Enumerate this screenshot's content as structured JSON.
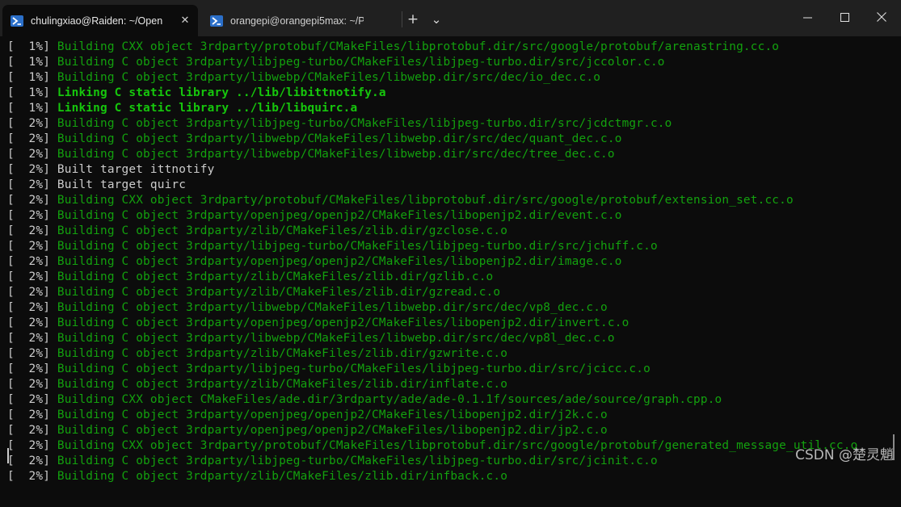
{
  "tabs": [
    {
      "title": "chulingxiao@Raiden: ~/Open",
      "active": true
    },
    {
      "title": "orangepi@orangepi5max: ~/P",
      "active": false
    }
  ],
  "titlebar": {
    "new_tab": "+",
    "dropdown": "⌄",
    "minimize": "─",
    "maximize": "□",
    "close": "✕"
  },
  "colors": {
    "normal_output": "#13a10e",
    "bold_output": "#16c60c",
    "default_text": "#cccccc",
    "background": "#0c0c0c"
  },
  "terminal_lines": [
    {
      "pct": "[  1%] ",
      "text": "Building CXX object 3rdparty/protobuf/CMakeFiles/libprotobuf.dir/src/google/protobuf/arenastring.cc.o",
      "style": "green"
    },
    {
      "pct": "[  1%] ",
      "text": "Building C object 3rdparty/libjpeg-turbo/CMakeFiles/libjpeg-turbo.dir/src/jccolor.c.o",
      "style": "green"
    },
    {
      "pct": "[  1%] ",
      "text": "Building C object 3rdparty/libwebp/CMakeFiles/libwebp.dir/src/dec/io_dec.c.o",
      "style": "green"
    },
    {
      "pct": "[  1%] ",
      "text": "Linking C static library ../lib/libittnotify.a",
      "style": "bright"
    },
    {
      "pct": "[  1%] ",
      "text": "Linking C static library ../lib/libquirc.a",
      "style": "bright"
    },
    {
      "pct": "[  2%] ",
      "text": "Building C object 3rdparty/libjpeg-turbo/CMakeFiles/libjpeg-turbo.dir/src/jcdctmgr.c.o",
      "style": "green"
    },
    {
      "pct": "[  2%] ",
      "text": "Building C object 3rdparty/libwebp/CMakeFiles/libwebp.dir/src/dec/quant_dec.c.o",
      "style": "green"
    },
    {
      "pct": "[  2%] ",
      "text": "Building C object 3rdparty/libwebp/CMakeFiles/libwebp.dir/src/dec/tree_dec.c.o",
      "style": "green"
    },
    {
      "pct": "[  2%] ",
      "text": "Built target ittnotify",
      "style": "white"
    },
    {
      "pct": "[  2%] ",
      "text": "Built target quirc",
      "style": "white"
    },
    {
      "pct": "[  2%] ",
      "text": "Building CXX object 3rdparty/protobuf/CMakeFiles/libprotobuf.dir/src/google/protobuf/extension_set.cc.o",
      "style": "green"
    },
    {
      "pct": "[  2%] ",
      "text": "Building C object 3rdparty/openjpeg/openjp2/CMakeFiles/libopenjp2.dir/event.c.o",
      "style": "green"
    },
    {
      "pct": "[  2%] ",
      "text": "Building C object 3rdparty/zlib/CMakeFiles/zlib.dir/gzclose.c.o",
      "style": "green"
    },
    {
      "pct": "[  2%] ",
      "text": "Building C object 3rdparty/libjpeg-turbo/CMakeFiles/libjpeg-turbo.dir/src/jchuff.c.o",
      "style": "green"
    },
    {
      "pct": "[  2%] ",
      "text": "Building C object 3rdparty/openjpeg/openjp2/CMakeFiles/libopenjp2.dir/image.c.o",
      "style": "green"
    },
    {
      "pct": "[  2%] ",
      "text": "Building C object 3rdparty/zlib/CMakeFiles/zlib.dir/gzlib.c.o",
      "style": "green"
    },
    {
      "pct": "[  2%] ",
      "text": "Building C object 3rdparty/zlib/CMakeFiles/zlib.dir/gzread.c.o",
      "style": "green"
    },
    {
      "pct": "[  2%] ",
      "text": "Building C object 3rdparty/libwebp/CMakeFiles/libwebp.dir/src/dec/vp8_dec.c.o",
      "style": "green"
    },
    {
      "pct": "[  2%] ",
      "text": "Building C object 3rdparty/openjpeg/openjp2/CMakeFiles/libopenjp2.dir/invert.c.o",
      "style": "green"
    },
    {
      "pct": "[  2%] ",
      "text": "Building C object 3rdparty/libwebp/CMakeFiles/libwebp.dir/src/dec/vp8l_dec.c.o",
      "style": "green"
    },
    {
      "pct": "[  2%] ",
      "text": "Building C object 3rdparty/zlib/CMakeFiles/zlib.dir/gzwrite.c.o",
      "style": "green"
    },
    {
      "pct": "[  2%] ",
      "text": "Building C object 3rdparty/libjpeg-turbo/CMakeFiles/libjpeg-turbo.dir/src/jcicc.c.o",
      "style": "green"
    },
    {
      "pct": "[  2%] ",
      "text": "Building C object 3rdparty/zlib/CMakeFiles/zlib.dir/inflate.c.o",
      "style": "green"
    },
    {
      "pct": "[  2%] ",
      "text": "Building CXX object CMakeFiles/ade.dir/3rdparty/ade/ade-0.1.1f/sources/ade/source/graph.cpp.o",
      "style": "green"
    },
    {
      "pct": "[  2%] ",
      "text": "Building C object 3rdparty/openjpeg/openjp2/CMakeFiles/libopenjp2.dir/j2k.c.o",
      "style": "green"
    },
    {
      "pct": "[  2%] ",
      "text": "Building C object 3rdparty/openjpeg/openjp2/CMakeFiles/libopenjp2.dir/jp2.c.o",
      "style": "green"
    },
    {
      "pct": "[  2%] ",
      "text": "Building CXX object 3rdparty/protobuf/CMakeFiles/libprotobuf.dir/src/google/protobuf/generated_message_util.cc.o",
      "style": "green"
    },
    {
      "pct": "[  2%] ",
      "text": "Building C object 3rdparty/libjpeg-turbo/CMakeFiles/libjpeg-turbo.dir/src/jcinit.c.o",
      "style": "green"
    },
    {
      "pct": "[  2%] ",
      "text": "Building C object 3rdparty/zlib/CMakeFiles/zlib.dir/infback.c.o",
      "style": "green"
    }
  ],
  "watermark": "CSDN @楚灵魈"
}
